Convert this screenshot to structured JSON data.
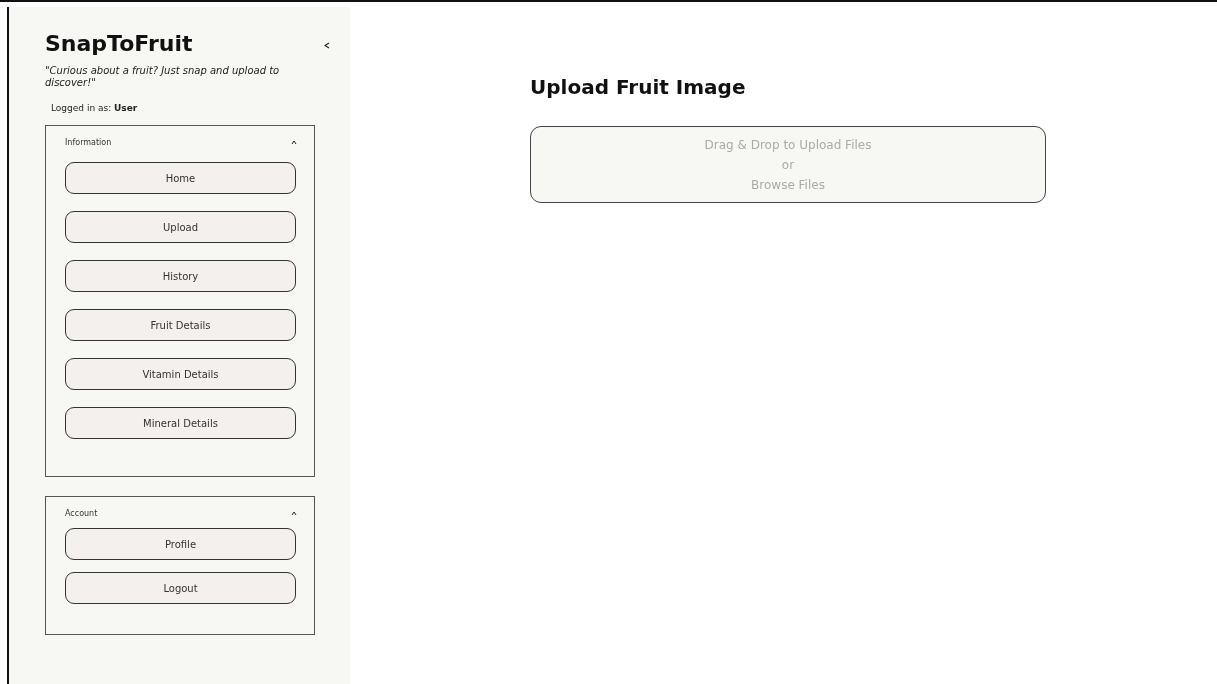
{
  "sidebar": {
    "app_title": "SnapToFruit",
    "tagline": "\"Curious about a fruit? Just snap and upload to discover!\"",
    "logged_in": "Logged in as: **User**",
    "sections": [
      {
        "title": "Information",
        "expanded": true,
        "items": [
          "Home",
          "Upload",
          "History",
          "Fruit Details",
          "Vitamin Details",
          "Mineral Details"
        ]
      },
      {
        "title": "Account",
        "expanded": true,
        "items": [
          "Profile",
          "Logout"
        ]
      }
    ]
  },
  "main": {
    "title": "Upload Fruit Image",
    "dropzone": {
      "lines": [
        "Drag & Drop to Upload Files",
        "or",
        "Browse Files"
      ]
    }
  }
}
